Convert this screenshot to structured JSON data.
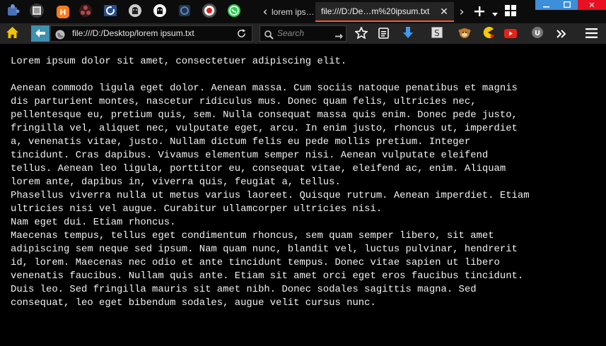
{
  "tabs": {
    "pinned": [
      {
        "icon": "puzzle-icon",
        "color": "#4a6fb5"
      },
      {
        "icon": "frame-icon",
        "color": "#c8c8c8"
      },
      {
        "icon": "hemlock-h-icon",
        "color": "#ff7a1a",
        "glyph": "H"
      },
      {
        "icon": "triangle-dots-icon",
        "color": "#b24a4a"
      },
      {
        "icon": "refresh-page-icon",
        "color": "#3b7bd6"
      },
      {
        "icon": "github-icon",
        "color": "#cccccc"
      },
      {
        "icon": "github-icon",
        "color": "#ffffff"
      },
      {
        "icon": "box-icon",
        "color": "#5a86b8"
      },
      {
        "icon": "record-icon",
        "color": "#e02020"
      },
      {
        "icon": "whatsapp-icon",
        "color": "#2ecc52"
      }
    ],
    "inactive_title": "lorem ips…",
    "active_title": "file:///D:/De…m%20ipsum.txt",
    "accent": "#ff5a24"
  },
  "nav": {
    "url": "file:///D:/Desktop/lorem ipsum.txt",
    "search_placeholder": "Search"
  },
  "document": {
    "text": "Lorem ipsum dolor sit amet, consectetuer adipiscing elit.\n\nAenean commodo ligula eget dolor. Aenean massa. Cum sociis natoque penatibus et magnis\ndis parturient montes, nascetur ridiculus mus. Donec quam felis, ultricies nec,\npellentesque eu, pretium quis, sem. Nulla consequat massa quis enim. Donec pede justo,\nfringilla vel, aliquet nec, vulputate eget, arcu. In enim justo, rhoncus ut, imperdiet\na, venenatis vitae, justo. Nullam dictum felis eu pede mollis pretium. Integer\ntincidunt. Cras dapibus. Vivamus elementum semper nisi. Aenean vulputate eleifend\ntellus. Aenean leo ligula, porttitor eu, consequat vitae, eleifend ac, enim. Aliquam\nlorem ante, dapibus in, viverra quis, feugiat a, tellus.\nPhasellus viverra nulla ut metus varius laoreet. Quisque rutrum. Aenean imperdiet. Etiam\nultricies nisi vel augue. Curabitur ullamcorper ultricies nisi.\nNam eget dui. Etiam rhoncus.\nMaecenas tempus, tellus eget condimentum rhoncus, sem quam semper libero, sit amet\nadipiscing sem neque sed ipsum. Nam quam nunc, blandit vel, luctus pulvinar, hendrerit\nid, lorem. Maecenas nec odio et ante tincidunt tempus. Donec vitae sapien ut libero\nvenenatis faucibus. Nullam quis ante. Etiam sit amet orci eget eros faucibus tincidunt.\nDuis leo. Sed fringilla mauris sit amet nibh. Donec sodales sagittis magna. Sed\nconsequat, leo eget bibendum sodales, augue velit cursus nunc."
  },
  "colors": {
    "window_controls": "#3c8fd8",
    "close_button": "#e81123",
    "tab_strip": "#0c0c0c",
    "toolbar": "#252525",
    "page_background": "#000000",
    "text": "#f2f2f2"
  }
}
